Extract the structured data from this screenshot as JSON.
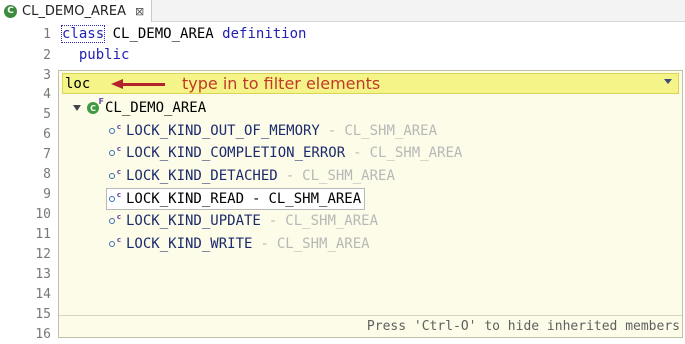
{
  "tab": {
    "title": "CL_DEMO_AREA",
    "close_glyph": "⊠",
    "icon": "class-icon"
  },
  "editor": {
    "line_numbers": [
      "1",
      "2",
      "3",
      "4",
      "5",
      "6",
      "7",
      "8",
      "9",
      "10",
      "11",
      "12",
      "13",
      "14",
      "15",
      "16"
    ],
    "line1": {
      "kw1": "class",
      "name": " CL_DEMO_AREA ",
      "kw2": "definition"
    },
    "line2": {
      "kw": "  public"
    }
  },
  "popup": {
    "filter_value": "loc",
    "annotation": "type in to filter elements",
    "root_label": "CL_DEMO_AREA",
    "separator": "-",
    "items": [
      {
        "name": "LOCK_KIND_OUT_OF_MEMORY",
        "parent": "CL_SHM_AREA"
      },
      {
        "name": "LOCK_KIND_COMPLETION_ERROR",
        "parent": "CL_SHM_AREA"
      },
      {
        "name": "LOCK_KIND_DETACHED",
        "parent": "CL_SHM_AREA"
      },
      {
        "name": "LOCK_KIND_READ",
        "parent": "CL_SHM_AREA"
      },
      {
        "name": "LOCK_KIND_UPDATE",
        "parent": "CL_SHM_AREA"
      },
      {
        "name": "LOCK_KIND_WRITE",
        "parent": "CL_SHM_AREA"
      }
    ],
    "footer": "Press 'Ctrl-O' to hide inherited members",
    "colors": {
      "background": "#fcfce8",
      "filter_highlight": "#f4f488",
      "annotation": "#c0392b"
    }
  }
}
